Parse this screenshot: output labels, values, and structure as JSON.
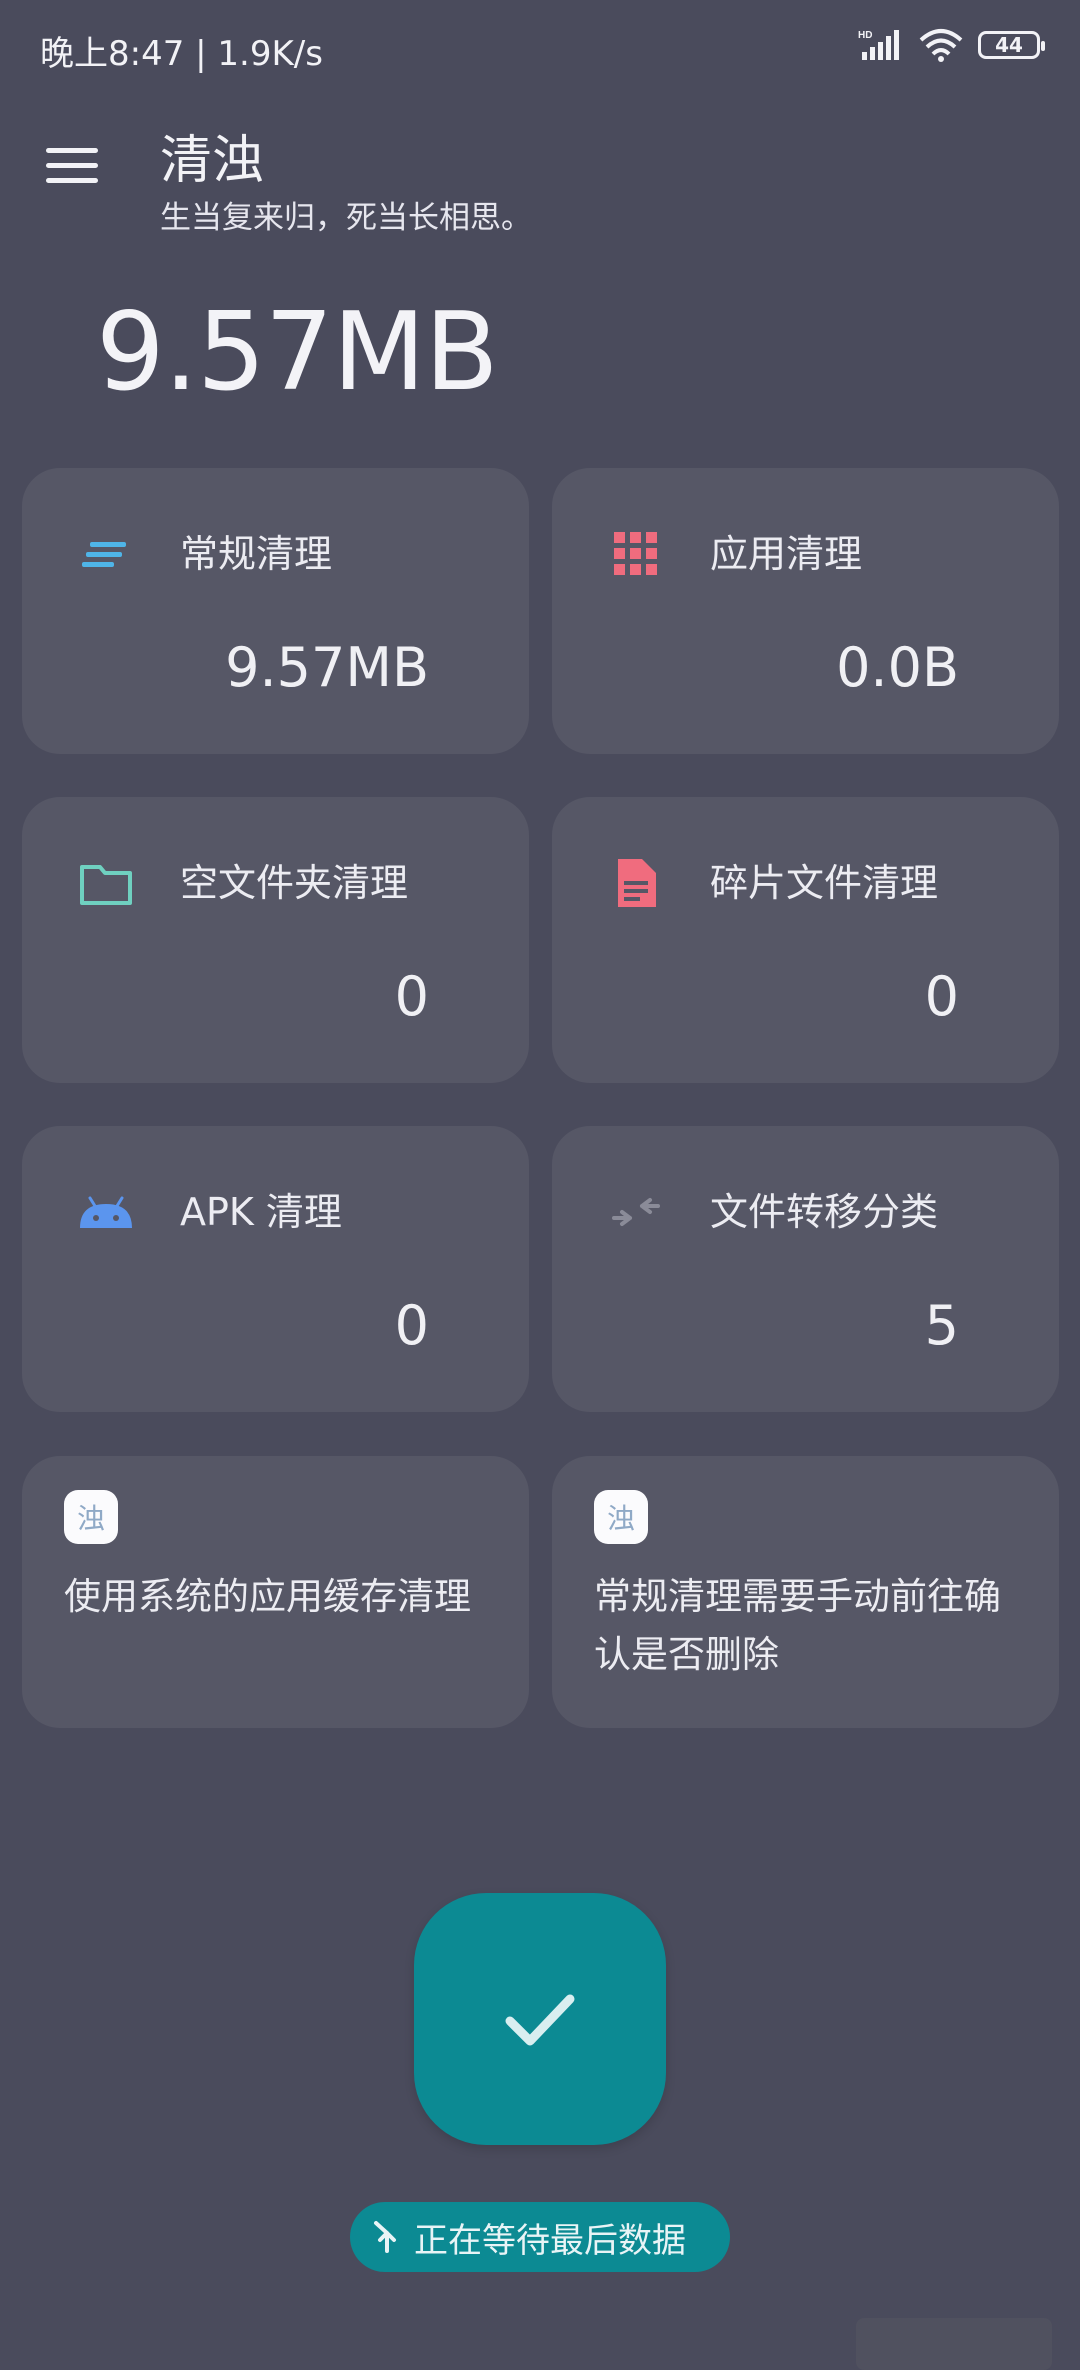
{
  "status_bar": {
    "time_speed": "晚上8:47 | 1.9K/s",
    "battery": "44",
    "signal_label": "HD"
  },
  "header": {
    "title": "清浊",
    "subtitle": "生当复来归，死当长相思。",
    "menu_icon": "menu-icon"
  },
  "summary": {
    "total_size": "9.57MB"
  },
  "cards": [
    {
      "label": "常规清理",
      "value": "9.57MB",
      "icon": "lines-icon",
      "icon_color": "#4fb5e8"
    },
    {
      "label": "应用清理",
      "value": "0.0B",
      "icon": "grid-icon",
      "icon_color": "#f06c7e"
    },
    {
      "label": "空文件夹清理",
      "value": "0",
      "icon": "folder-icon",
      "icon_color": "#6fd0c0"
    },
    {
      "label": "碎片文件清理",
      "value": "0",
      "icon": "document-icon",
      "icon_color": "#f06c7e"
    },
    {
      "label": "APK 清理",
      "value": "0",
      "icon": "android-icon",
      "icon_color": "#5b95ee"
    },
    {
      "label": "文件转移分类",
      "value": "5",
      "icon": "transfer-arrows-icon",
      "icon_color": "#8a8b98"
    }
  ],
  "tips": [
    {
      "logo": "浊",
      "text": "使用系统的应用缓存清理"
    },
    {
      "logo": "浊",
      "text": "常规清理需要手动前往确认是否删除"
    }
  ],
  "fab": {
    "icon": "check-icon",
    "color": "#0c8a93"
  },
  "status_chip": {
    "text": "正在等待最后数据",
    "icon": "merge-arrow-icon"
  }
}
